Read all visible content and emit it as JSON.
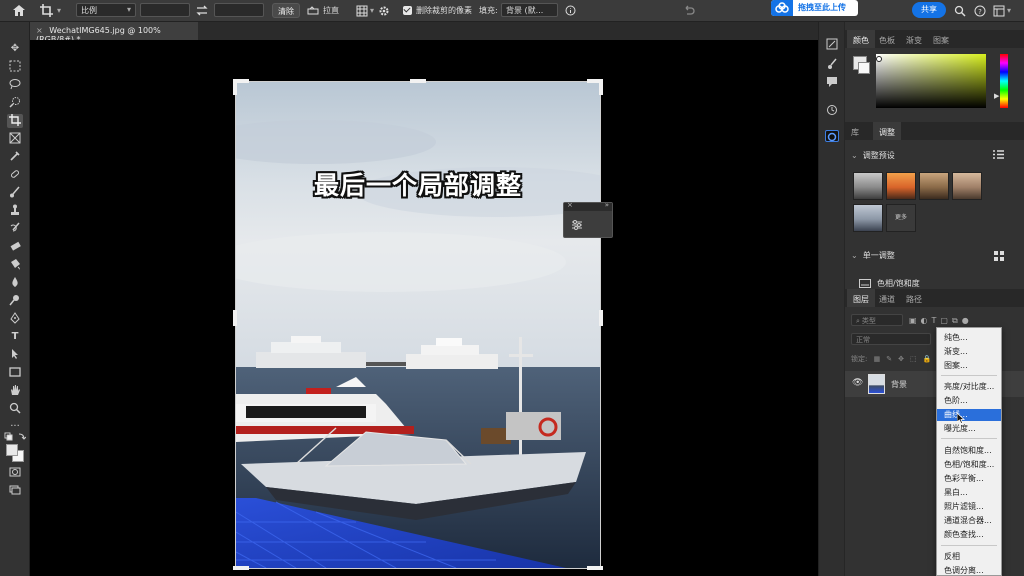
{
  "options_bar": {
    "ratio_label": "比例",
    "clear_label": "清除",
    "straighten_label": "拉直",
    "delete_cropped_label": "删除裁剪的像素",
    "fill_label": "填充:",
    "fill_value": "背景 (默...",
    "upload_label": "拖拽至此上传",
    "share_label": "共享"
  },
  "document": {
    "tab_title": "WechatIMG645.jpg @ 100%(RGB/8#) *",
    "overlay_text": "最后一个局部调整"
  },
  "color_panel": {
    "tabs": [
      "颜色",
      "色板",
      "渐变",
      "图案"
    ],
    "active_tab": "颜色",
    "foreground": "#e8e8e8",
    "hue_color": "#d7ef1e"
  },
  "adjust_panel": {
    "tabs": [
      "库",
      "调整"
    ],
    "active_tab": "调整",
    "presets_header": "调整预设",
    "more_label": "更多",
    "single_header": "单一调整",
    "hue_sat_label": "色相/饱和度"
  },
  "layers_panel": {
    "tabs": [
      "图层",
      "通道",
      "路径"
    ],
    "active_tab": "图层",
    "filter_placeholder": "类型",
    "blend_mode": "正常",
    "lock_label": "锁定:",
    "layer_name": "背景"
  },
  "adjust_menu": {
    "groups": [
      [
        "纯色...",
        "渐变...",
        "图案..."
      ],
      [
        "亮度/对比度...",
        "色阶...",
        "曲线...",
        "曝光度..."
      ],
      [
        "自然饱和度...",
        "色相/饱和度...",
        "色彩平衡...",
        "黑白...",
        "照片滤镜...",
        "通道混合器...",
        "颜色查找..."
      ],
      [
        "反相",
        "色调分离..."
      ]
    ],
    "selected": "曲线..."
  },
  "icons": [
    "home-icon",
    "crop-icon",
    "swap-icon",
    "straighten-icon",
    "gear-icon",
    "undo-icon",
    "search-icon",
    "help-icon",
    "workspace-icon"
  ]
}
